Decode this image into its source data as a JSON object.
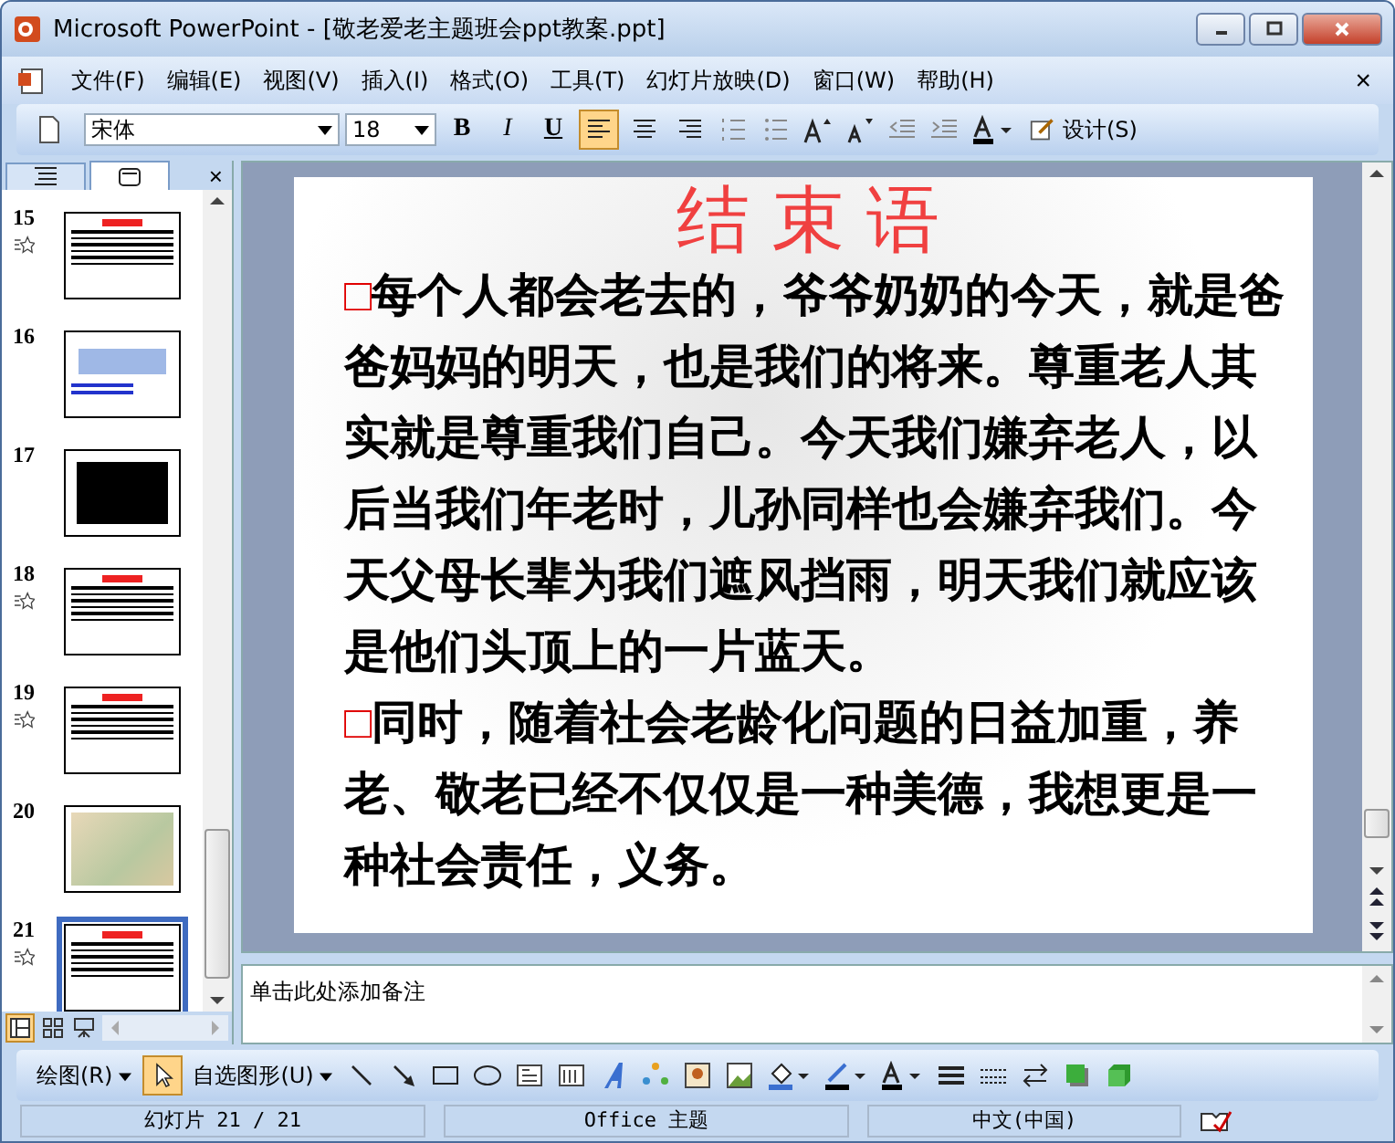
{
  "window": {
    "title": "Microsoft PowerPoint - [敬老爱老主题班会ppt教案.ppt]"
  },
  "menu": [
    "文件(F)",
    "编辑(E)",
    "视图(V)",
    "插入(I)",
    "格式(O)",
    "工具(T)",
    "幻灯片放映(D)",
    "窗口(W)",
    "帮助(H)"
  ],
  "menu_close": "×",
  "toolbar": {
    "font": "宋体",
    "size": "18",
    "bold": "B",
    "italic": "I",
    "underline": "U",
    "align_left_selected": true,
    "design": "设计(S)"
  },
  "pane_tabs": [
    {
      "kind": "outline",
      "selected": false
    },
    {
      "kind": "slides",
      "selected": true
    }
  ],
  "pane_close": "×",
  "slides": [
    {
      "number": "15",
      "animated": true,
      "kind": "text",
      "selected": false
    },
    {
      "number": "16",
      "animated": false,
      "kind": "title",
      "selected": false
    },
    {
      "number": "17",
      "animated": false,
      "kind": "black",
      "selected": false
    },
    {
      "number": "18",
      "animated": true,
      "kind": "text",
      "selected": false
    },
    {
      "number": "19",
      "animated": true,
      "kind": "text",
      "selected": false
    },
    {
      "number": "20",
      "animated": false,
      "kind": "picture",
      "selected": false
    },
    {
      "number": "21",
      "animated": true,
      "kind": "text",
      "selected": true
    }
  ],
  "slide": {
    "title": "结束语",
    "paragraphs": [
      {
        "marker": "□",
        "text": "每个人都会老去的，爷爷奶奶的今天，就是爸爸妈妈的明天，也是我们的将来。尊重老人其实就是尊重我们自己。今天我们嫌弃老人，以后当我们年老时，儿孙同样也会嫌弃我们。今天父母长辈为我们遮风挡雨，明天我们就应该是他们头顶上的一片蓝天。"
      },
      {
        "marker": "□",
        "text": "同时，随着社会老龄化问题的日益加重，养老、敬老已经不仅仅是一种美德，我想更是一种社会责任，义务。"
      }
    ]
  },
  "notes": {
    "placeholder": "单击此处添加备注"
  },
  "drawing_toolbar": {
    "draw": "绘图(R)",
    "autoshapes": "自选图形(U)"
  },
  "status_bar": [
    "幻灯片 21 / 21",
    "Office 主题",
    "中文(中国)"
  ]
}
